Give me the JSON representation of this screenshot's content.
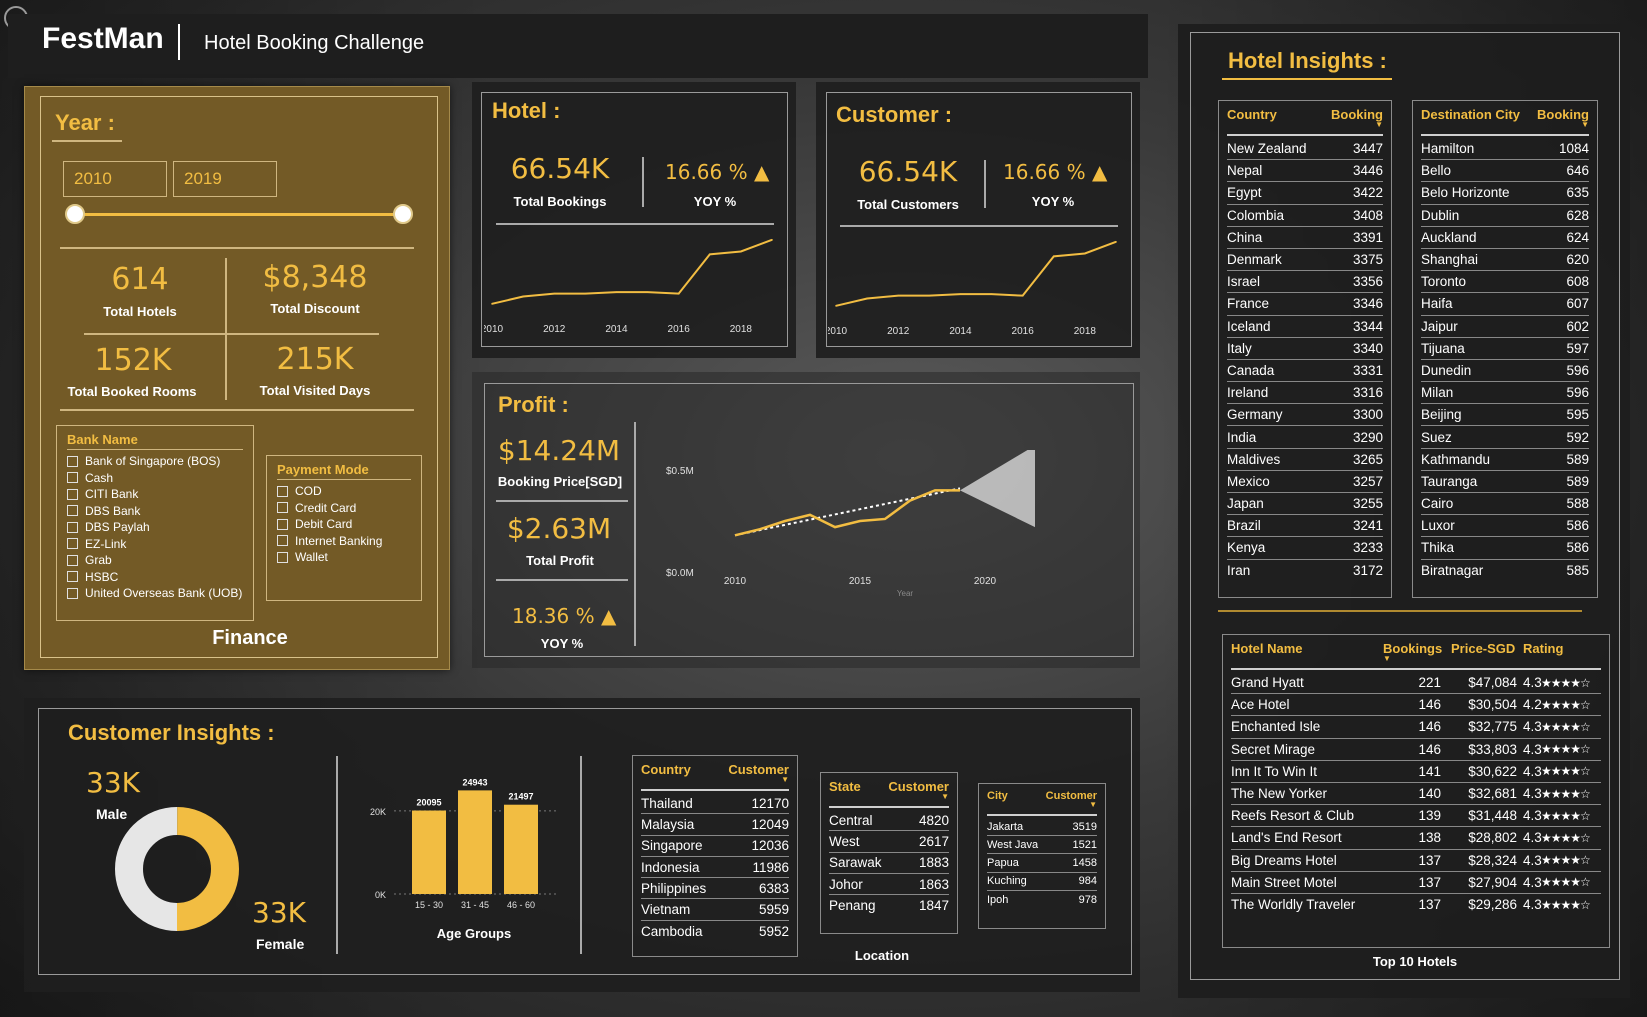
{
  "header": {
    "brand": "FestMan",
    "title": "Hotel Booking Challenge"
  },
  "colors": {
    "accent": "#f2bd42",
    "finance_bg": "#735a26",
    "panel_bg": "#1e1e1e",
    "donut_grey": "#e6e6e6"
  },
  "finance": {
    "year_heading": "Year :",
    "year_from": "2010",
    "year_to": "2019",
    "kpis": {
      "hotels_value": "614",
      "hotels_label": "Total Hotels",
      "discount_value": "$8,348",
      "discount_label": "Total Discount",
      "rooms_value": "152K",
      "rooms_label": "Total Booked Rooms",
      "days_value": "215K",
      "days_label": "Total Visited Days"
    },
    "bank_title": "Bank Name",
    "banks": [
      "Bank of Singapore (BOS)",
      "Cash",
      "CITI Bank",
      "DBS Bank",
      "DBS Paylah",
      "EZ-Link",
      "Grab",
      "HSBC",
      "United Overseas Bank (UOB)"
    ],
    "payment_title": "Payment Mode",
    "payments": [
      "COD",
      "Credit Card",
      "Debit Card",
      "Internet Banking",
      "Wallet"
    ],
    "footer": "Finance"
  },
  "hotel": {
    "heading": "Hotel :",
    "value": "66.54K",
    "value_label": "Total Bookings",
    "yoy": "16.66 %",
    "yoy_label": "YOY %",
    "x_ticks": [
      "2010",
      "2012",
      "2014",
      "2016",
      "2018"
    ]
  },
  "customer": {
    "heading": "Customer :",
    "value": "66.54K",
    "value_label": "Total Customers",
    "yoy": "16.66 %",
    "yoy_label": "YOY %",
    "x_ticks": [
      "2010",
      "2012",
      "2014",
      "2016",
      "2018"
    ]
  },
  "profit": {
    "heading": "Profit :",
    "booking_value": "$14.24M",
    "booking_label": "Booking Price[SGD]",
    "profit_value": "$2.63M",
    "profit_label": "Total Profit",
    "yoy": "18.36 %",
    "yoy_label": "YOY %",
    "y_ticks": [
      "$0.5M",
      "$0.0M"
    ],
    "x_ticks": [
      "2010",
      "2015",
      "2020"
    ],
    "x_axis_title": "Year"
  },
  "customer_insights": {
    "heading": "Customer Insights :",
    "male_value": "33K",
    "male_label": "Male",
    "female_value": "33K",
    "female_label": "Female",
    "age_title": "Age Groups",
    "age_y_ticks": [
      "20K",
      "0K"
    ],
    "country_head": "Country",
    "customer_head": "Customer",
    "countries": [
      {
        "name": "Thailand",
        "value": "12170"
      },
      {
        "name": "Malaysia",
        "value": "12049"
      },
      {
        "name": "Singapore",
        "value": "12036"
      },
      {
        "name": "Indonesia",
        "value": "11986"
      },
      {
        "name": "Philippines",
        "value": "6383"
      },
      {
        "name": "Vietnam",
        "value": "5959"
      },
      {
        "name": "Cambodia",
        "value": "5952"
      }
    ],
    "state_head": "State",
    "states": [
      {
        "name": "Central",
        "value": "4820"
      },
      {
        "name": "West",
        "value": "2617"
      },
      {
        "name": "Sarawak",
        "value": "1883"
      },
      {
        "name": "Johor",
        "value": "1863"
      },
      {
        "name": "Penang",
        "value": "1847"
      }
    ],
    "city_head": "City",
    "cities": [
      {
        "name": "Jakarta",
        "value": "3519"
      },
      {
        "name": "West Java",
        "value": "1521"
      },
      {
        "name": "Papua",
        "value": "1458"
      },
      {
        "name": "Kuching",
        "value": "984"
      },
      {
        "name": "Ipoh",
        "value": "978"
      }
    ],
    "location_label": "Location"
  },
  "hotel_insights": {
    "heading": "Hotel Insights :",
    "country_head": "Country",
    "booking_head": "Booking",
    "countries": [
      {
        "name": "New Zealand",
        "value": "3447"
      },
      {
        "name": "Nepal",
        "value": "3446"
      },
      {
        "name": "Egypt",
        "value": "3422"
      },
      {
        "name": "Colombia",
        "value": "3408"
      },
      {
        "name": "China",
        "value": "3391"
      },
      {
        "name": "Denmark",
        "value": "3375"
      },
      {
        "name": "Israel",
        "value": "3356"
      },
      {
        "name": "France",
        "value": "3346"
      },
      {
        "name": "Iceland",
        "value": "3344"
      },
      {
        "name": "Italy",
        "value": "3340"
      },
      {
        "name": "Canada",
        "value": "3331"
      },
      {
        "name": "Ireland",
        "value": "3316"
      },
      {
        "name": "Germany",
        "value": "3300"
      },
      {
        "name": "India",
        "value": "3290"
      },
      {
        "name": "Maldives",
        "value": "3265"
      },
      {
        "name": "Mexico",
        "value": "3257"
      },
      {
        "name": "Japan",
        "value": "3255"
      },
      {
        "name": "Brazil",
        "value": "3241"
      },
      {
        "name": "Kenya",
        "value": "3233"
      },
      {
        "name": "Iran",
        "value": "3172"
      }
    ],
    "dest_head": "Destination City",
    "destinations": [
      {
        "name": "Hamilton",
        "value": "1084"
      },
      {
        "name": "Bello",
        "value": "646"
      },
      {
        "name": "Belo Horizonte",
        "value": "635"
      },
      {
        "name": "Dublin",
        "value": "628"
      },
      {
        "name": "Auckland",
        "value": "624"
      },
      {
        "name": "Shanghai",
        "value": "620"
      },
      {
        "name": "Toronto",
        "value": "608"
      },
      {
        "name": "Haifa",
        "value": "607"
      },
      {
        "name": "Jaipur",
        "value": "602"
      },
      {
        "name": "Tijuana",
        "value": "597"
      },
      {
        "name": "Dunedin",
        "value": "596"
      },
      {
        "name": "Milan",
        "value": "596"
      },
      {
        "name": "Beijing",
        "value": "595"
      },
      {
        "name": "Suez",
        "value": "592"
      },
      {
        "name": "Kathmandu",
        "value": "589"
      },
      {
        "name": "Tauranga",
        "value": "589"
      },
      {
        "name": "Cairo",
        "value": "588"
      },
      {
        "name": "Luxor",
        "value": "586"
      },
      {
        "name": "Thika",
        "value": "586"
      },
      {
        "name": "Biratnagar",
        "value": "585"
      }
    ],
    "top_head": {
      "name": "Hotel Name",
      "bookings": "Bookings",
      "price": "Price-SGD",
      "rating": "Rating"
    },
    "top_hotels": [
      {
        "name": "Grand Hyatt",
        "bookings": "221",
        "price": "$47,084",
        "rating": "4.3",
        "stars": "★★★★☆"
      },
      {
        "name": "Ace Hotel",
        "bookings": "146",
        "price": "$30,504",
        "rating": "4.2",
        "stars": "★★★★☆"
      },
      {
        "name": "Enchanted Isle",
        "bookings": "146",
        "price": "$32,775",
        "rating": "4.3",
        "stars": "★★★★☆"
      },
      {
        "name": "Secret Mirage",
        "bookings": "146",
        "price": "$33,803",
        "rating": "4.3",
        "stars": "★★★★☆"
      },
      {
        "name": "Inn It To Win It",
        "bookings": "141",
        "price": "$30,622",
        "rating": "4.3",
        "stars": "★★★★☆"
      },
      {
        "name": "The New Yorker",
        "bookings": "140",
        "price": "$32,681",
        "rating": "4.3",
        "stars": "★★★★☆"
      },
      {
        "name": "Reefs Resort & Club",
        "bookings": "139",
        "price": "$31,448",
        "rating": "4.3",
        "stars": "★★★★☆"
      },
      {
        "name": "Land's End Resort",
        "bookings": "138",
        "price": "$28,802",
        "rating": "4.3",
        "stars": "★★★★☆"
      },
      {
        "name": "Big Dreams Hotel",
        "bookings": "137",
        "price": "$28,324",
        "rating": "4.3",
        "stars": "★★★★☆"
      },
      {
        "name": "Main Street Motel",
        "bookings": "137",
        "price": "$27,904",
        "rating": "4.3",
        "stars": "★★★★☆"
      },
      {
        "name": "The Worldly Traveler",
        "bookings": "137",
        "price": "$29,286",
        "rating": "4.3",
        "stars": "★★★★☆"
      }
    ],
    "top_label": "Top 10 Hotels"
  },
  "chart_data": [
    {
      "type": "line",
      "x": [
        2010,
        2011,
        2012,
        2013,
        2014,
        2015,
        2016,
        2017,
        2018,
        2019
      ],
      "y": [
        5200,
        5700,
        5900,
        5900,
        6000,
        6000,
        5900,
        8600,
        8800,
        9600
      ]
    },
    {
      "type": "line",
      "x": [
        2010,
        2011,
        2012,
        2013,
        2014,
        2015,
        2016,
        2017,
        2018,
        2019
      ],
      "y": [
        5200,
        5700,
        5900,
        5900,
        6000,
        6000,
        5900,
        8600,
        8800,
        9600
      ]
    },
    {
      "type": "line",
      "x": [
        2010,
        2011,
        2012,
        2013,
        2014,
        2015,
        2016,
        2017,
        2018,
        2019
      ],
      "y": [
        0.18,
        0.21,
        0.25,
        0.28,
        0.22,
        0.25,
        0.26,
        0.35,
        0.4,
        0.4
      ],
      "trend": [
        [
          2010,
          0.18
        ],
        [
          2019,
          0.41
        ]
      ],
      "forecast_band": {
        "x": [
          2019,
          2022
        ],
        "low": [
          0.4,
          0.22
        ],
        "high": [
          0.4,
          0.62
        ]
      },
      "ylim": [
        0,
        0.5
      ],
      "xlabel": "Year"
    },
    {
      "type": "bar",
      "categories": [
        "15 - 30",
        "31 - 45",
        "46 - 60"
      ],
      "values": [
        20095,
        24943,
        21497
      ],
      "ylim": [
        0,
        26000
      ],
      "xlabel": "Age Groups"
    },
    {
      "type": "pie",
      "categories": [
        "Male",
        "Female"
      ],
      "values": [
        33000,
        33000
      ]
    }
  ]
}
